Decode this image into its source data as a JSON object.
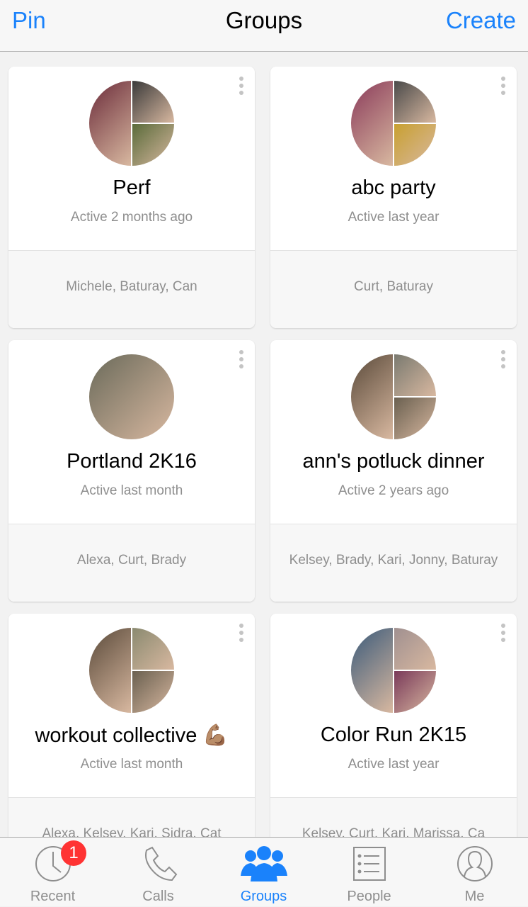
{
  "header": {
    "left_button": "Pin",
    "title": "Groups",
    "right_button": "Create"
  },
  "groups": [
    {
      "name": "Perf",
      "active": "Active 2 months ago",
      "members": "Michele, Baturay, Can",
      "photos": [
        "#6b2b3a",
        "#3a3a3a",
        "#5a6b3a"
      ]
    },
    {
      "name": "abc party",
      "active": "Active last year",
      "members": "Curt, Baturay",
      "photos": [
        "#8a3a5a",
        "#4a4a4a",
        "#c8a030"
      ]
    },
    {
      "name": "Portland 2K16",
      "active": "Active last month",
      "members": "Alexa, Curt, Brady",
      "photos": [
        "#6a6a5a"
      ]
    },
    {
      "name": "ann's potluck dinner",
      "active": "Active 2 years ago",
      "members": "Kelsey, Brady, Kari, Jonny, Baturay",
      "photos": [
        "#5a4a3a",
        "#7a7a70",
        "#6a6050"
      ]
    },
    {
      "name": "workout collective 💪🏽",
      "active": "Active last month",
      "members": "Alexa, Kelsey, Kari, Sidra, Cat",
      "photos": [
        "#5a4a3a",
        "#8a8a70",
        "#6a6050"
      ]
    },
    {
      "name": "Color Run 2K15",
      "active": "Active last year",
      "members": "Kelsey, Curt, Kari, Marissa, Ca",
      "photos": [
        "#3a5a7a",
        "#a09090",
        "#7a3a5a"
      ]
    }
  ],
  "tabs": [
    {
      "label": "Recent",
      "icon": "clock-icon",
      "badge": "1",
      "selected": false
    },
    {
      "label": "Calls",
      "icon": "phone-icon",
      "selected": false
    },
    {
      "label": "Groups",
      "icon": "groups-icon",
      "selected": true
    },
    {
      "label": "People",
      "icon": "list-icon",
      "selected": false
    },
    {
      "label": "Me",
      "icon": "person-icon",
      "selected": false
    }
  ],
  "colors": {
    "accent": "#1a82fb",
    "badge": "#ff3333"
  }
}
